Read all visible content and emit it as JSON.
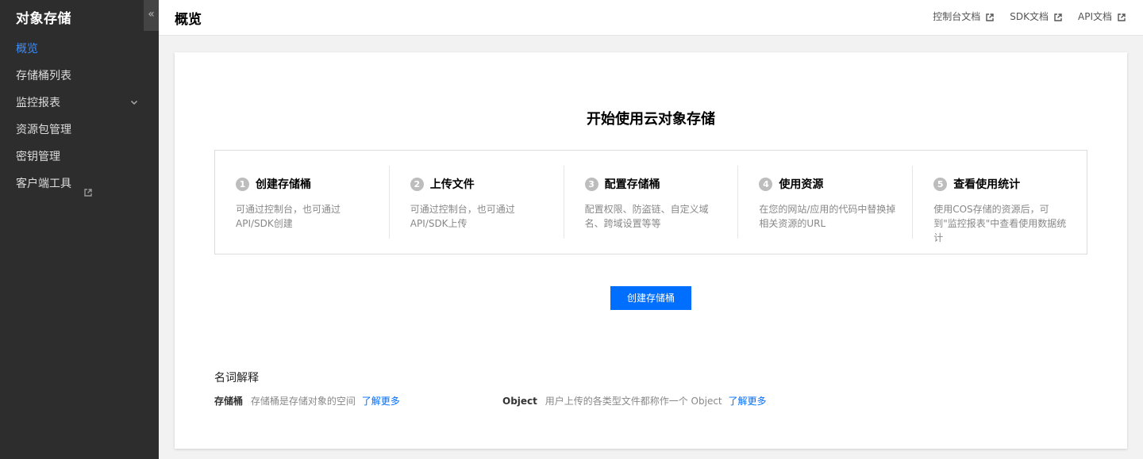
{
  "sidebar": {
    "brand": "对象存储",
    "collapse_glyph": "«",
    "items": [
      {
        "label": "概览",
        "active": true
      },
      {
        "label": "存储桶列表"
      },
      {
        "label": "监控报表",
        "has_submenu": true
      },
      {
        "label": "资源包管理"
      },
      {
        "label": "密钥管理"
      },
      {
        "label": "客户端工具",
        "external": true
      }
    ]
  },
  "header": {
    "title": "概览",
    "links": [
      "控制台文档",
      "SDK文档",
      "API文档"
    ]
  },
  "main": {
    "heading": "开始使用云对象存储",
    "steps": [
      {
        "num": "1",
        "title": "创建存储桶",
        "desc": "可通过控制台，也可通过API/SDK创建"
      },
      {
        "num": "2",
        "title": "上传文件",
        "desc": "可通过控制台，也可通过API/SDK上传"
      },
      {
        "num": "3",
        "title": "配置存储桶",
        "desc": "配置权限、防盗链、自定义域名、跨域设置等等"
      },
      {
        "num": "4",
        "title": "使用资源",
        "desc": "在您的网站/应用的代码中替换掉相关资源的URL"
      },
      {
        "num": "5",
        "title": "查看使用统计",
        "desc": "使用COS存储的资源后，可到\"监控报表\"中查看使用数据统计"
      }
    ],
    "create_button": "创建存储桶",
    "glossary": {
      "title": "名词解释",
      "items": [
        {
          "term": "存储桶",
          "definition": "存储桶是存储对象的空间",
          "more": "了解更多"
        },
        {
          "term": "Object",
          "definition": "用户上传的各类型文件都称作一个 Object",
          "more": "了解更多"
        }
      ]
    }
  },
  "colors": {
    "sidebar_bg": "#2d2d2d",
    "active": "#3b8dff",
    "primary": "#006eff"
  },
  "icons": {
    "external": "external-link-icon",
    "chevron": "chevron-down-icon"
  }
}
